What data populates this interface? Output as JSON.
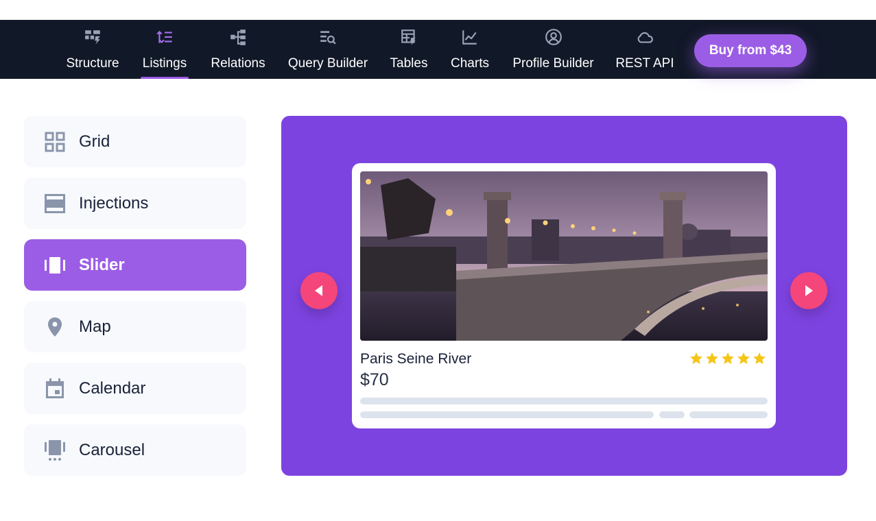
{
  "nav": {
    "items": [
      {
        "label": "Structure",
        "icon": "structure-icon"
      },
      {
        "label": "Listings",
        "icon": "listings-icon"
      },
      {
        "label": "Relations",
        "icon": "relations-icon"
      },
      {
        "label": "Query Builder",
        "icon": "query-builder-icon"
      },
      {
        "label": "Tables",
        "icon": "tables-icon"
      },
      {
        "label": "Charts",
        "icon": "charts-icon"
      },
      {
        "label": "Profile Builder",
        "icon": "profile-icon"
      },
      {
        "label": "REST API",
        "icon": "cloud-icon"
      }
    ],
    "active": "Listings",
    "buy_label": "Buy from $43"
  },
  "sidebar": {
    "items": [
      {
        "label": "Grid",
        "icon": "grid-icon"
      },
      {
        "label": "Injections",
        "icon": "injections-icon"
      },
      {
        "label": "Slider",
        "icon": "slider-icon"
      },
      {
        "label": "Map",
        "icon": "map-pin-icon"
      },
      {
        "label": "Calendar",
        "icon": "calendar-icon"
      },
      {
        "label": "Carousel",
        "icon": "carousel-icon"
      }
    ],
    "active": "Slider"
  },
  "card": {
    "title": "Paris Seine River",
    "price": "$70",
    "rating": 5
  },
  "colors": {
    "nav_bg": "#111827",
    "accent": "#9b5de5",
    "panel_bg": "#7d43e0",
    "arrow": "#f4467a",
    "star": "#f5c518"
  }
}
